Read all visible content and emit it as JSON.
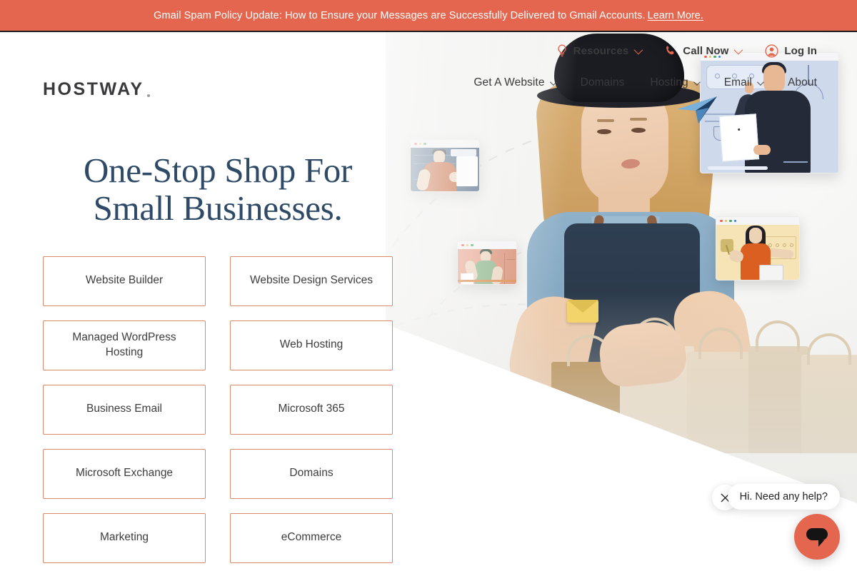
{
  "announcement": {
    "text": "Gmail Spam Policy Update: How to Ensure your Messages are Successfully Delivered to Gmail Accounts.",
    "link_label": "Learn More.",
    "background_color": "#e4664e"
  },
  "utility_nav": {
    "items": [
      {
        "label": "Resources",
        "icon": "lightbulb-icon",
        "has_chevron": true
      },
      {
        "label": "Call Now",
        "icon": "phone-icon",
        "has_chevron": true
      },
      {
        "label": "Log In",
        "icon": "user-circle-icon",
        "has_chevron": false
      }
    ]
  },
  "brand": {
    "logo_text": "HOSTWAY",
    "logo_color": "#3a3a3c",
    "accent_color": "#e4664e"
  },
  "main_nav": {
    "items": [
      {
        "label": "Get A Website",
        "has_chevron": true
      },
      {
        "label": "Domains",
        "has_chevron": false
      },
      {
        "label": "Hosting",
        "has_chevron": true
      },
      {
        "label": "Email",
        "has_chevron": true
      },
      {
        "label": "About",
        "has_chevron": false
      }
    ]
  },
  "hero": {
    "title": "One-Stop Shop For Small Businesses.",
    "title_color": "#2e4a66",
    "service_buttons": [
      {
        "label": "Website Builder"
      },
      {
        "label": "Website Design Services"
      },
      {
        "label": "Managed WordPress Hosting"
      },
      {
        "label": "Web Hosting"
      },
      {
        "label": "Business Email"
      },
      {
        "label": "Microsoft 365"
      },
      {
        "label": "Microsoft Exchange"
      },
      {
        "label": "Domains"
      },
      {
        "label": "Marketing"
      },
      {
        "label": "eCommerce"
      }
    ],
    "button_border_color": "#d98a6d"
  },
  "chat_widget": {
    "greeting": "Hi. Need any help?",
    "close_icon": "close-icon",
    "launcher_icon": "chat-bubble-icon",
    "launcher_color": "#e4664e"
  }
}
